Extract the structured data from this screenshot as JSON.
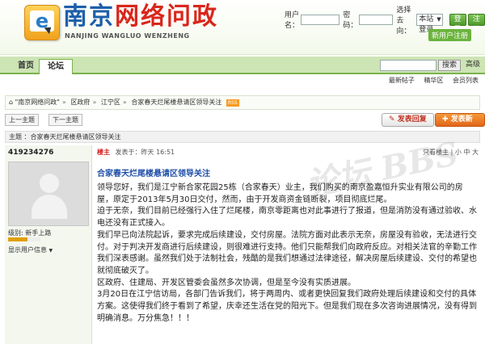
{
  "header": {
    "title_a": "南京",
    "title_b": "网络问政",
    "subtitle": "NANJING WANGLUO WENZHENG",
    "username_label": "用户名：",
    "password_label": "密码：",
    "select_label": "选择去向：",
    "select_value": "本站登录",
    "login_btn": "登录",
    "register_btn": "注册",
    "new_user": "新用户注册"
  },
  "nav": {
    "home": "首页",
    "forum": "论坛",
    "search_btn": "搜索",
    "advanced": "高级",
    "sub": [
      "最新帖子",
      "精华区",
      "会员列表"
    ]
  },
  "breadcrumb": {
    "items": [
      "\"南京网络问政\"",
      "区政府",
      "江宁区",
      "合家春天烂尾楼悬请区领导关注"
    ],
    "rss": "RSS"
  },
  "pager": {
    "prev": "上一主题",
    "next": "下一主题",
    "reply": "发表回复",
    "new_post": "发表新帖"
  },
  "thread_bar": "主题 ：合家春天烂尾楼悬请区领导关注",
  "author": {
    "name": "419234276",
    "level": "级别: 新手上路",
    "menu": "显示用户信息"
  },
  "post": {
    "tag": "楼主",
    "time": "发表于：昨天  16:51",
    "tools": "只看楼主  |  小  中  大",
    "title": "合家春天烂尾楼悬请区领导关注",
    "paragraphs": [
      "领导您好，我们是江宁新合家花园25栋（合家春天）业主，我们购买的南京盈嘉恒升实业有限公司的房屋，原定于2013年5月30日交付，然而，由于开发商资金链断裂，项目彻底烂尾。",
      "迫于无奈，我们目前已经强行入住了烂尾楼，南京零距离也对此事进行了报道，但是消防没有通过验收、水电还没有正式接入。",
      "我们早已向法院起诉，要求完成后续建设，交付房屋。法院方面对此表示无奈，房屋没有验收，无法进行交付。对于判决开发商进行后续建设，则很难进行支持。他们只能帮我们向政府反应。对相关法官的辛勤工作我们深表感谢。虽然我们处于法制社会，残酷的是我们想通过法律途径，解决房屋后续建设、交付的希望也就彻底破灭了。",
      "区政府、住建局、开发区管委会虽然多次协调，但是至今没有实质进展。",
      "3月20日在江宁信访局，各部门告诉我们，将于两周内、或者更快回复我们政府处理后续建设和交付的具体方案。这使得我们终于看到了希望，庆幸还生活在党的阳光下。但是我们现在多次咨询进展情况，没有得到明确消息。万分焦急！！！"
    ]
  }
}
